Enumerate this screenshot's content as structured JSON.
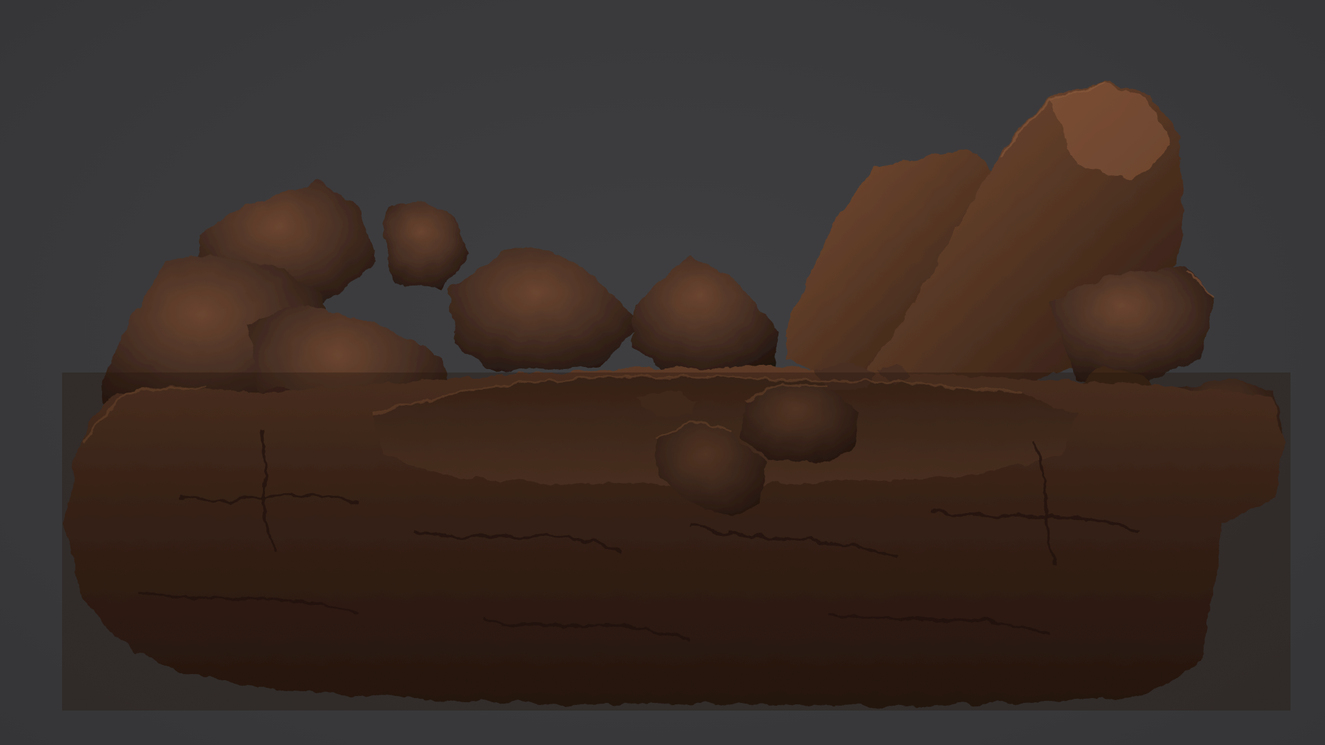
{
  "viewport": {
    "background": "#3a3a3c"
  },
  "model": {
    "material_base": "#4a3125",
    "material_shadow": "#1a0f0a",
    "material_highlight": "#7a5236",
    "material_rim": "#9a6a45"
  }
}
